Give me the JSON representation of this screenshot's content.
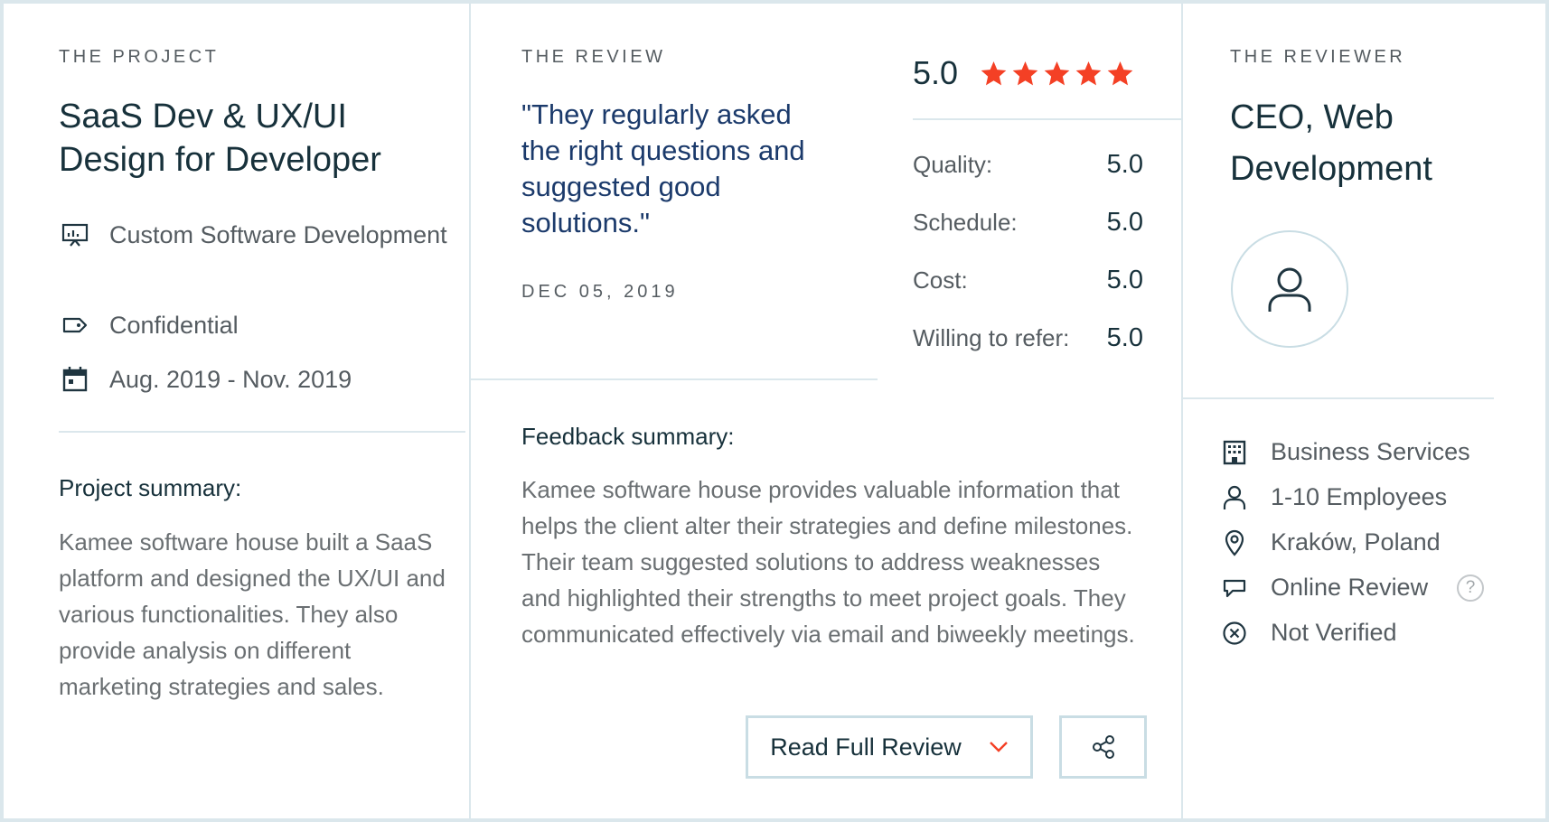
{
  "project": {
    "eyebrow": "THE PROJECT",
    "title": "SaaS Dev & UX/UI Design for Developer",
    "details": [
      {
        "icon": "presentation-icon",
        "text": "Custom Software Development"
      },
      {
        "icon": "price-tag-icon",
        "text": "Confidential"
      },
      {
        "icon": "calendar-icon",
        "text": "Aug. 2019 - Nov. 2019"
      }
    ],
    "summary_title": "Project summary:",
    "summary": "Kamee software house built a SaaS platform and designed the UX/UI and various functionalities. They also provide analysis on different marketing strategies and sales."
  },
  "review": {
    "eyebrow": "THE REVIEW",
    "quote": "\"They regularly asked the right questions and suggested good solutions.\"",
    "date": "DEC 05, 2019",
    "overall_score": "5.0",
    "stars": 5,
    "star_color": "#f44025",
    "ratings": [
      {
        "label": "Quality:",
        "value": "5.0"
      },
      {
        "label": "Schedule:",
        "value": "5.0"
      },
      {
        "label": "Cost:",
        "value": "5.0"
      },
      {
        "label": "Willing to refer:",
        "value": "5.0"
      }
    ],
    "feedback_title": "Feedback summary:",
    "feedback": "Kamee software house provides valuable information that helps the client alter their strategies and define milestones. Their team suggested solutions to address weaknesses and highlighted their strengths to meet project goals. They communicated effectively via email and biweekly meetings.",
    "read_full_label": "Read Full Review",
    "read_full_icon": "chevron-down-icon",
    "share_icon": "share-icon"
  },
  "reviewer": {
    "eyebrow": "THE REVIEWER",
    "title": "CEO, Web Development",
    "avatar_icon": "user-icon",
    "details": [
      {
        "icon": "building-icon",
        "text": "Business Services"
      },
      {
        "icon": "person-icon",
        "text": "1-10 Employees"
      },
      {
        "icon": "location-pin-icon",
        "text": "Kraków, Poland"
      },
      {
        "icon": "speech-bubble-icon",
        "text": "Online Review"
      },
      {
        "icon": "x-circle-icon",
        "text": "Not Verified"
      }
    ],
    "help_label": "?"
  },
  "colors": {
    "border": "#dbe7ec",
    "accent_red": "#f44025",
    "quote_blue": "#1b3a6b",
    "text_dark": "#17313b",
    "text_muted": "#555c61"
  }
}
